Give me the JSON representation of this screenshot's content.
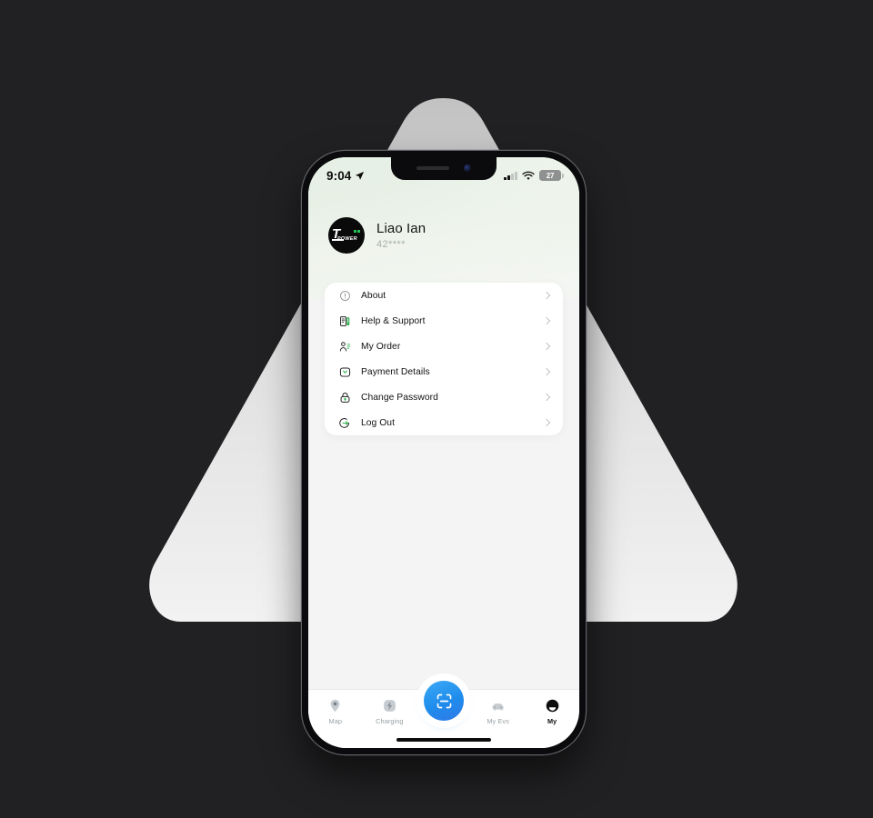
{
  "background": {
    "page_color": "#212123",
    "shape": "rounded-triangle",
    "shape_color_top": "#c4c4c4",
    "shape_color_bottom": "#f1f1f1"
  },
  "phone": {
    "frame_color": "#0b0b0d",
    "screen_background": "#f4f4f4"
  },
  "status_bar": {
    "time": "9:04",
    "location_icon": "location-arrow-icon",
    "cellular_icon": "cellular-bars-icon",
    "wifi_icon": "wifi-icon",
    "battery_level": "27"
  },
  "header": {
    "accent_green": "#e4eee2",
    "avatar": {
      "brand_mark": "T",
      "brand_word": "POWER",
      "dot_color": "#25c255",
      "background": "#0a0a0a"
    },
    "user_name": "Liao Ian",
    "user_phone_masked": "42****"
  },
  "menu": {
    "items": [
      {
        "icon": "info-circle-icon",
        "label": "About",
        "chevron": "chevron-right-icon"
      },
      {
        "icon": "help-document-icon",
        "label": "Help & Support",
        "chevron": "chevron-right-icon"
      },
      {
        "icon": "order-person-icon",
        "label": "My Order",
        "chevron": "chevron-right-icon"
      },
      {
        "icon": "wallet-icon",
        "label": "Payment Details",
        "chevron": "chevron-right-icon"
      },
      {
        "icon": "lock-icon",
        "label": "Change Password",
        "chevron": "chevron-right-icon"
      },
      {
        "icon": "logout-arrow-icon",
        "label": "Log Out",
        "chevron": "chevron-right-icon"
      }
    ]
  },
  "tabbar": {
    "accent_blue": "#1f8cec",
    "tabs": [
      {
        "icon": "map-pin-icon",
        "label": "Map",
        "active": false
      },
      {
        "icon": "bolt-icon",
        "label": "Charging",
        "active": false
      },
      {
        "icon": "car-icon",
        "label": "My Evs",
        "active": false
      },
      {
        "icon": "person-icon",
        "label": "My",
        "active": true
      }
    ],
    "scan_button": {
      "icon": "scan-qr-icon",
      "label": "Scan"
    }
  }
}
